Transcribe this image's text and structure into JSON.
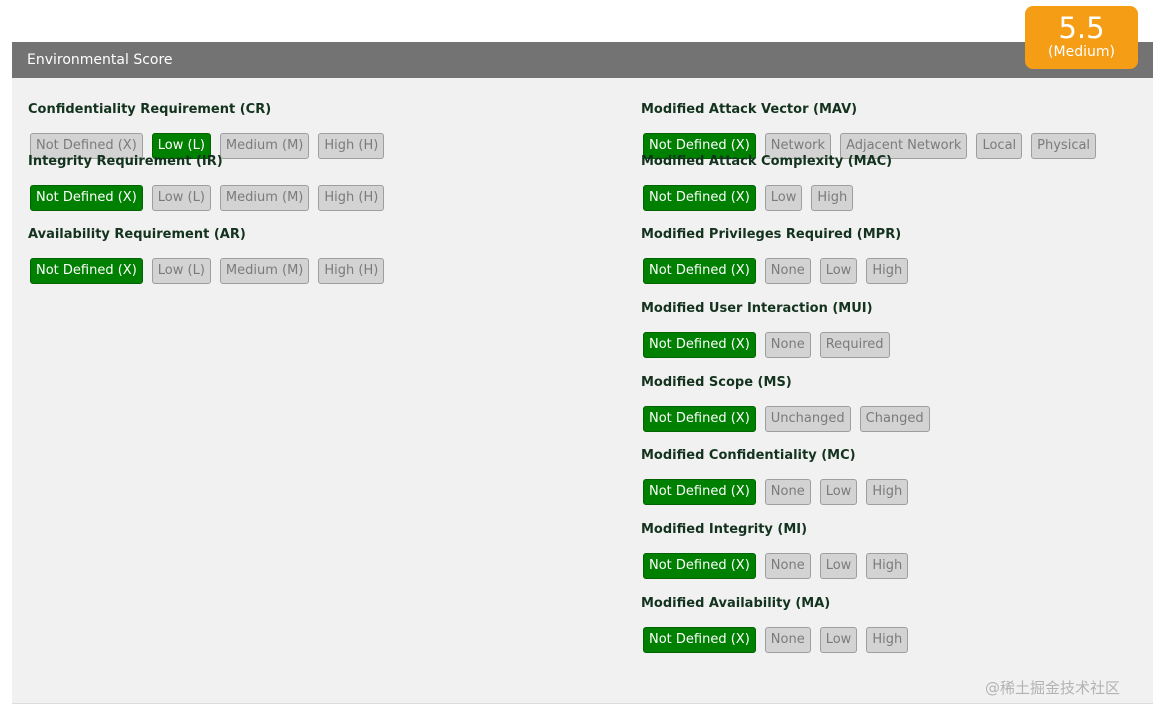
{
  "header": {
    "title": "Environmental Score"
  },
  "score": {
    "value": "5.5",
    "rating": "(Medium)",
    "color": "#f49d15"
  },
  "colors": {
    "selected": "#008000",
    "unselected": "#d3d3d3",
    "header": "#737373"
  },
  "left_metrics": [
    {
      "label": "Confidentiality Requirement (CR)",
      "options": [
        "Not Defined (X)",
        "Low (L)",
        "Medium (M)",
        "High (H)"
      ],
      "selected": 1
    },
    {
      "label": "Integrity Requirement (IR)",
      "options": [
        "Not Defined (X)",
        "Low (L)",
        "Medium (M)",
        "High (H)"
      ],
      "selected": 0
    },
    {
      "label": "Availability Requirement (AR)",
      "options": [
        "Not Defined (X)",
        "Low (L)",
        "Medium (M)",
        "High (H)"
      ],
      "selected": 0
    }
  ],
  "right_metrics": [
    {
      "label": "Modified Attack Vector (MAV)",
      "options": [
        "Not Defined (X)",
        "Network",
        "Adjacent Network",
        "Local",
        "Physical"
      ],
      "selected": 0
    },
    {
      "label": "Modified Attack Complexity (MAC)",
      "options": [
        "Not Defined (X)",
        "Low",
        "High"
      ],
      "selected": 0
    },
    {
      "label": "Modified Privileges Required (MPR)",
      "options": [
        "Not Defined (X)",
        "None",
        "Low",
        "High"
      ],
      "selected": 0
    },
    {
      "label": "Modified User Interaction (MUI)",
      "options": [
        "Not Defined (X)",
        "None",
        "Required"
      ],
      "selected": 0
    },
    {
      "label": "Modified Scope (MS)",
      "options": [
        "Not Defined (X)",
        "Unchanged",
        "Changed"
      ],
      "selected": 0
    },
    {
      "label": "Modified Confidentiality (MC)",
      "options": [
        "Not Defined (X)",
        "None",
        "Low",
        "High"
      ],
      "selected": 0
    },
    {
      "label": "Modified Integrity (MI)",
      "options": [
        "Not Defined (X)",
        "None",
        "Low",
        "High"
      ],
      "selected": 0
    },
    {
      "label": "Modified Availability (MA)",
      "options": [
        "Not Defined (X)",
        "None",
        "Low",
        "High"
      ],
      "selected": 0
    }
  ],
  "watermark": "@稀土掘金技术社区"
}
